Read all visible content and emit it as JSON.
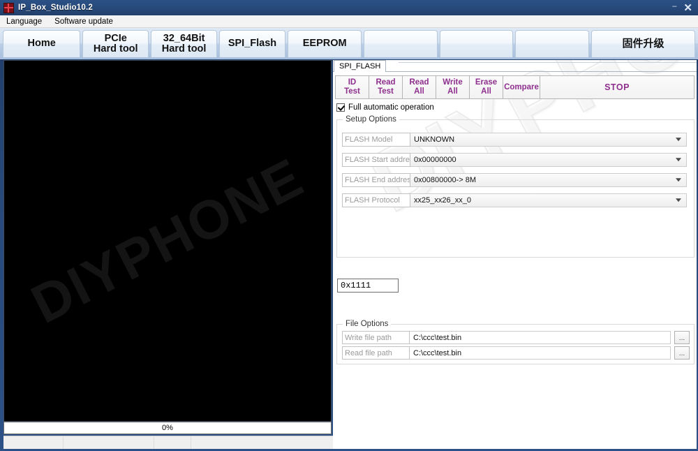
{
  "window": {
    "title": "IP_Box_Studio10.2",
    "icon": "app-grid-icon",
    "minimize_label": "–",
    "close_label": "✕"
  },
  "menubar": {
    "items": [
      {
        "label": "Language"
      },
      {
        "label": "Software update"
      }
    ]
  },
  "ribbon": {
    "tabs": [
      {
        "label": "Home",
        "name": "tab-home"
      },
      {
        "label": "PCIe\nHard tool",
        "name": "tab-pcie-hard-tool"
      },
      {
        "label": "32_64Bit\nHard tool",
        "name": "tab-32-64bit-hard-tool"
      },
      {
        "label": "SPI_Flash",
        "name": "tab-spi-flash"
      },
      {
        "label": "EEPROM",
        "name": "tab-eeprom"
      },
      {
        "label": "",
        "name": "tab-blank-1"
      },
      {
        "label": "",
        "name": "tab-blank-2"
      },
      {
        "label": "",
        "name": "tab-blank-3"
      },
      {
        "label": "固件升级",
        "name": "tab-firmware-upgrade"
      }
    ]
  },
  "left_panel": {
    "watermark": "DIYPHONE",
    "background_color": "#000000",
    "progress": {
      "label": "0%",
      "value": 0
    },
    "status_cells": [
      "",
      "",
      "",
      ""
    ]
  },
  "right_panel": {
    "watermark": "DIYPHONE",
    "sheet_tab": "SPI_FLASH",
    "action_buttons": [
      {
        "label": "ID\nTest",
        "name": "id-test-button"
      },
      {
        "label": "Read\nTest",
        "name": "read-test-button"
      },
      {
        "label": "Read\nAll",
        "name": "read-all-button"
      },
      {
        "label": "Write\nAll",
        "name": "write-all-button"
      },
      {
        "label": "Erase\nAll",
        "name": "erase-all-button"
      },
      {
        "label": "Compare",
        "name": "compare-button"
      },
      {
        "label": "STOP",
        "name": "stop-button"
      }
    ],
    "action_button_color": "#8e2f8e",
    "auto_checkbox": {
      "label": "Full automatic operation",
      "checked": true
    },
    "setup_options": {
      "title": "Setup Options",
      "fields": [
        {
          "label": "FLASH Model",
          "value": "UNKNOWN"
        },
        {
          "label": "FLASH Start address",
          "value": "0x00000000"
        },
        {
          "label": "FLASH End address",
          "value": "0x00800000->  8M"
        },
        {
          "label": "FLASH Protocol",
          "value": "xx25_xx26_xx_0"
        }
      ]
    },
    "hex_field": {
      "value": "0x1111"
    },
    "file_options": {
      "title": "File Options",
      "rows": [
        {
          "label": "Write file path",
          "value": "C:\\ccc\\test.bin",
          "browse_label": "..."
        },
        {
          "label": "Read file path",
          "value": "C:\\ccc\\test.bin",
          "browse_label": "..."
        }
      ]
    }
  }
}
